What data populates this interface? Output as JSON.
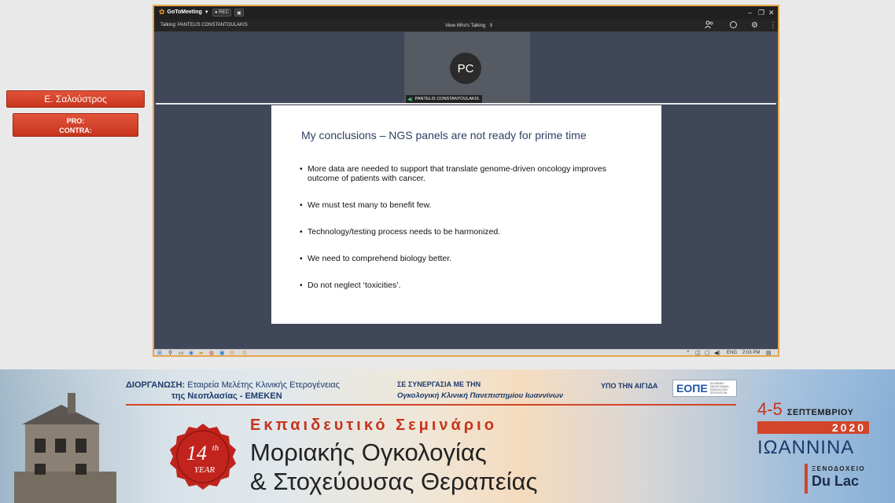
{
  "side_labels": {
    "speaker": "Ε. Σαλούστρος",
    "pro": "PRO:",
    "contra": "CONTRA:"
  },
  "app": {
    "name": "GoToMeeting",
    "rec_chip": "● REC",
    "talking": "Talking: PANTELIS CONSTANTOULAKIS",
    "view_mode": "View Who's Talking",
    "participant_initials": "PC",
    "participant_name": "PANTELIS CONSTANTOULAKIS",
    "accent_color": "#e6a64b"
  },
  "icons": {
    "participants": "people-icon",
    "chat": "chat-icon",
    "settings": "gear-icon",
    "more": "more-vertical-icon"
  },
  "slide": {
    "title": "My conclusions – NGS panels are not ready for prime time",
    "bullets": [
      "More data are needed to support that translate genome-driven oncology improves outcome of patients with cancer.",
      "We must test many to benefit few.",
      "Technology/testing process needs to be harmonized.",
      "We need to comprehend biology better.",
      "Do not neglect ‘toxicities’."
    ]
  },
  "taskbar": {
    "lang": "ENG",
    "time": "2:03 PM"
  },
  "banner": {
    "org_label": "ΔΙΟΡΓΑΝΩΣΗ:",
    "org_line1": "Εταιρεία Μελέτης Κλινικής Ετερογένειας",
    "org_line2": "της Νεοπλασίας - ΕΜΕΚΕΝ",
    "coop_label": "ΣΕ ΣΥΝΕΡΓΑΣΙΑ ΜΕ ΤΗΝ",
    "coop_name": "Ογκολογική Κλινική Πανεπιστημίου Ιωαννίνων",
    "aegis": "ΥΠΟ ΤΗΝ ΑΙΓΙΔΑ",
    "eope_logo": "ΕΟΠΕ",
    "eope_sub": "ΕΛΛΗΝΙΚΗ ΟΜΟΣΠΟΝΔΙΑ ΠΑΘΟΛΟΓΩΝ ΟΓΚΟΛΟΓΩΝ",
    "badge_number": "14",
    "badge_suffix": "th",
    "badge_year": "YEAR",
    "seminar_title": "Εκπαιδευτικό Σεμινάριο",
    "main_line1": "Μοριακής Ογκολογίας",
    "main_line2": "& Στοχεύουσας Θεραπείας",
    "date_days": "4-5",
    "date_month": "ΣΕΠΤΕΜΒΡΙΟΥ",
    "date_year": "2020",
    "city": "ΙΩΑΝΝΙΝΑ",
    "hotel_label": "ΞΕΝΟΔΟΧΕΙΟ",
    "hotel_name": "Du Lac",
    "brand_red": "#d2452a",
    "brand_blue": "#1b3a6b"
  }
}
